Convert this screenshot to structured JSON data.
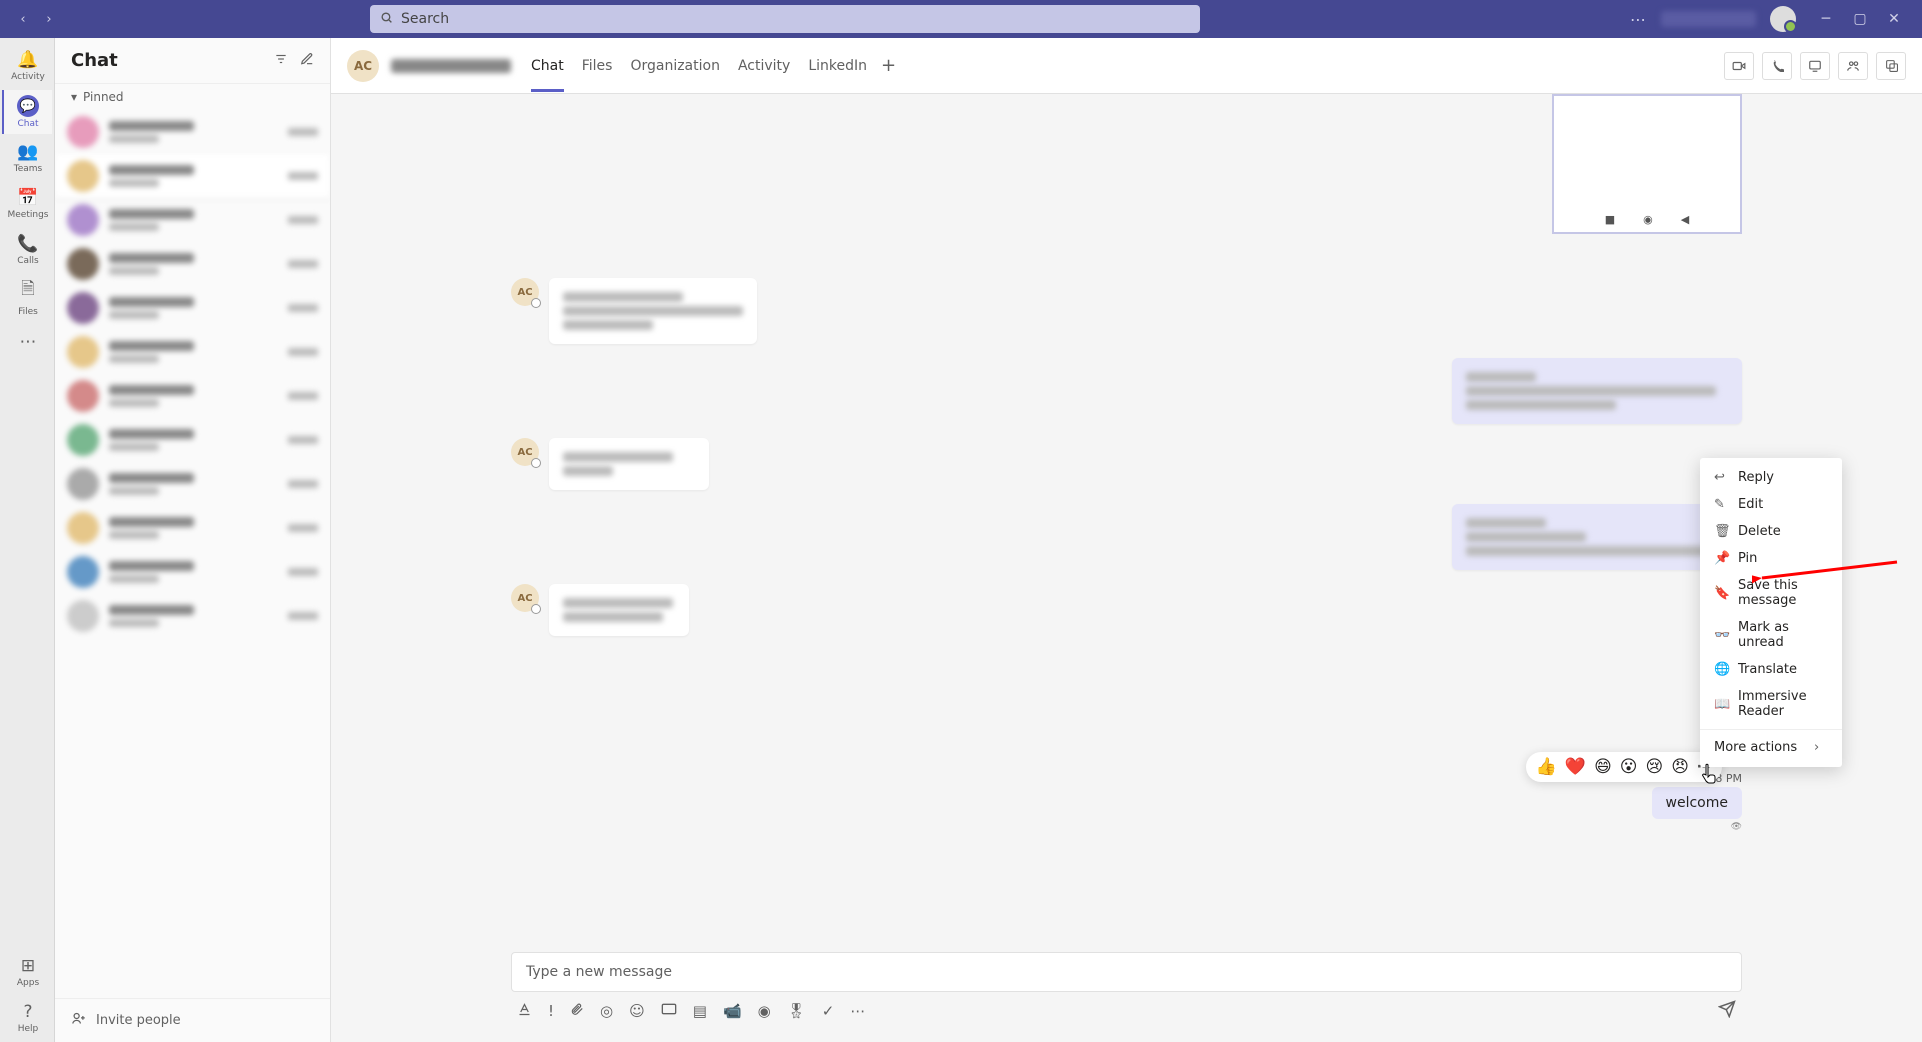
{
  "app": {
    "search_placeholder": "Search"
  },
  "rail": {
    "activity": "Activity",
    "chat": "Chat",
    "teams": "Teams",
    "meetings": "Meetings",
    "calls": "Calls",
    "files": "Files",
    "apps": "Apps",
    "help": "Help"
  },
  "chat_panel": {
    "title": "Chat",
    "pinned_label": "Pinned",
    "invite_label": "Invite people"
  },
  "chat_header": {
    "avatar_initials": "AC",
    "tabs": {
      "chat": "Chat",
      "files": "Files",
      "organization": "Organization",
      "activity": "Activity",
      "linkedin": "LinkedIn"
    }
  },
  "last_message": {
    "timestamp": "3:18 PM",
    "text": "welcome"
  },
  "context_menu": {
    "reply": "Reply",
    "edit": "Edit",
    "delete": "Delete",
    "pin": "Pin",
    "save": "Save this message",
    "mark_unread": "Mark as unread",
    "translate": "Translate",
    "immersive": "Immersive Reader",
    "more_actions": "More actions"
  },
  "reactions": {
    "like": "👍",
    "heart": "❤️",
    "laugh": "😄",
    "surprised": "😮",
    "sad": "😢",
    "angry": "😠"
  },
  "compose": {
    "placeholder": "Type a new message"
  },
  "received_avatar": "AC"
}
